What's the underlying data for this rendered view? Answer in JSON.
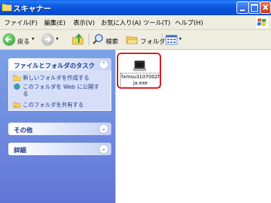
{
  "window": {
    "title": "スキャナー"
  },
  "menubar": {
    "items": [
      "ファイル(F)",
      "編集(E)",
      "表示(V)",
      "お気に入り(A)",
      "ツール(T)",
      "ヘルプ(H)"
    ]
  },
  "toolbar": {
    "back_label": "戻る",
    "search_label": "検索",
    "folders_label": "フォルダ"
  },
  "taskpane": {
    "file_folder_tasks": {
      "title": "ファイルとフォルダのタスク",
      "tasks": [
        {
          "icon": "new-folder-icon",
          "label": "新しいフォルダを作成する"
        },
        {
          "icon": "globe-publish-icon",
          "label_line1": "このフォルダを Web に公開す",
          "label_line2": "る"
        },
        {
          "icon": "share-folder-icon",
          "label": "このフォルダを共有する"
        }
      ]
    },
    "other": {
      "title": "その他"
    },
    "details": {
      "title": "詳細"
    }
  },
  "files": [
    {
      "name_line1": "fxmsu3107002f",
      "name_line2": "ja.exe",
      "icon": "installer-exe-icon",
      "highlighted": true
    }
  ],
  "colors": {
    "titlebar": "#0a5fe8",
    "taskpane": "#6f8fde",
    "highlight": "#e01010"
  }
}
